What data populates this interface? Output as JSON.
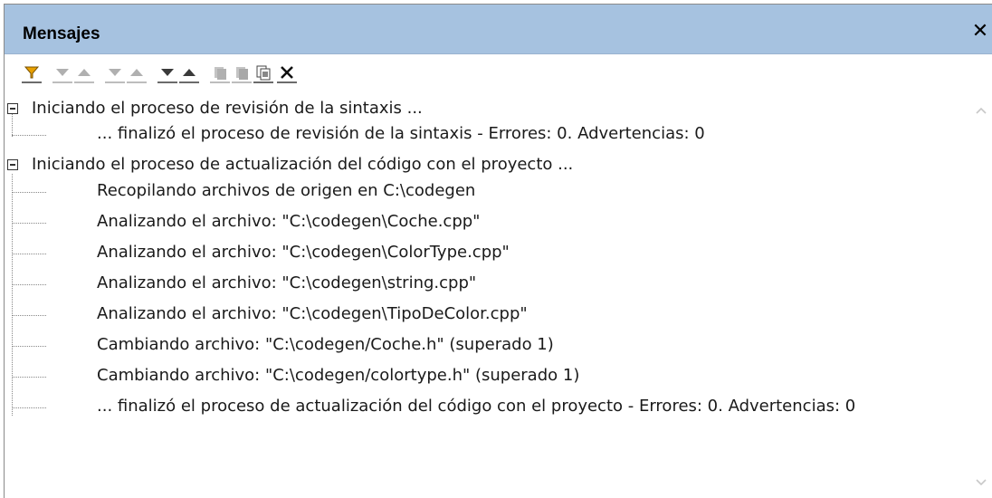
{
  "panel": {
    "title": "Mensajes",
    "close_icon": "close-icon"
  },
  "toolbar": {
    "buttons": [
      {
        "icon": "filter-icon",
        "enabled": true
      },
      {
        "icon": "next-icon",
        "enabled": false
      },
      {
        "icon": "previous-icon",
        "enabled": false
      },
      {
        "icon": "next-error-icon",
        "enabled": false
      },
      {
        "icon": "previous-error-icon",
        "enabled": false
      },
      {
        "icon": "next-warning-icon",
        "enabled": true
      },
      {
        "icon": "previous-warning-icon",
        "enabled": true
      },
      {
        "icon": "copy-line-icon",
        "enabled": false
      },
      {
        "icon": "copy-all-icon",
        "enabled": false
      },
      {
        "icon": "copy-selected-icon",
        "enabled": true
      },
      {
        "icon": "clear-icon",
        "enabled": true
      }
    ]
  },
  "messages": {
    "groups": [
      {
        "label": "Iniciando el proceso de revisión de la sintaxis ...",
        "children": [
          "... finalizó el proceso de revisión de la sintaxis - Errores: 0. Advertencias: 0"
        ]
      },
      {
        "label": "Iniciando el proceso de actualización del código con el proyecto ...",
        "children": [
          "Recopilando archivos de origen en C:\\codegen",
          "Analizando el archivo: \"C:\\codegen\\Coche.cpp\"",
          "Analizando el archivo: \"C:\\codegen\\ColorType.cpp\"",
          "Analizando el archivo: \"C:\\codegen\\string.cpp\"",
          "Analizando el archivo: \"C:\\codegen\\TipoDeColor.cpp\"",
          "Cambiando archivo: \"C:\\codegen/Coche.h\" (superado 1)",
          "Cambiando archivo: \"C:\\codegen/colortype.h\" (superado 1)",
          "... finalizó el proceso de actualización del código con el proyecto - Errores: 0. Advertencias: 0"
        ]
      }
    ]
  }
}
